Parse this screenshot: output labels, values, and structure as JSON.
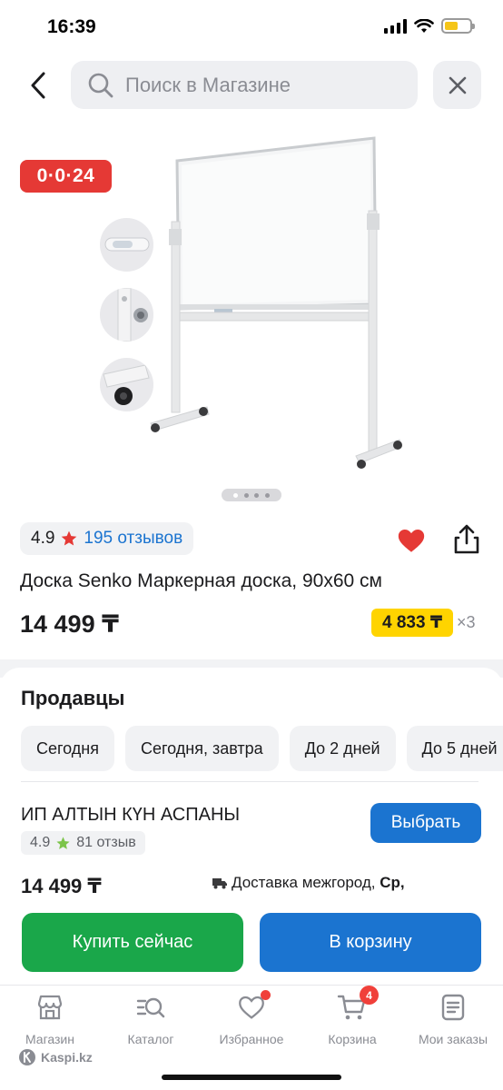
{
  "status_bar": {
    "time": "16:39"
  },
  "header": {
    "search_placeholder": "Поиск в Магазине"
  },
  "gallery": {
    "timer": "0·0·24",
    "thumbnails": 3,
    "dots_total": 4,
    "dots_active": 1
  },
  "product": {
    "rating": "4.9",
    "reviews": "195 отзывов",
    "title": "Доска Senko Маркерная доска, 90x60 см",
    "price": "14 499 ₸",
    "installment_amount": "4 833 ₸",
    "installment_months": "×3",
    "favorite_color": "#e53935"
  },
  "sellers": {
    "title": "Продавцы",
    "delivery_chips": [
      "Сегодня",
      "Сегодня, завтра",
      "До 2 дней",
      "До 5 дней"
    ],
    "first_seller": {
      "name": "ИП АЛТЫН КҮН АСПАНЫ",
      "rating": "4.9",
      "reviews": "81 отзыв",
      "choose_label": "Выбрать",
      "price": "14 499 ₸",
      "delivery_prefix": "Доставка межгород, ",
      "delivery_day": "Ср,"
    }
  },
  "actions": {
    "buy_now": "Купить сейчас",
    "add_to_cart": "В корзину"
  },
  "tab_bar": {
    "items": [
      {
        "label": "Магазин",
        "icon": "store-icon"
      },
      {
        "label": "Каталог",
        "icon": "catalog-search-icon"
      },
      {
        "label": "Избранное",
        "icon": "heart-icon"
      },
      {
        "label": "Корзина",
        "icon": "cart-icon",
        "badge": "4"
      },
      {
        "label": "Мои заказы",
        "icon": "orders-icon"
      }
    ]
  },
  "watermark": "Kaspi.kz",
  "colors": {
    "brand_blue": "#1b74d0",
    "buy_green": "#1aa74a",
    "timer_red": "#e53935",
    "installment_yellow": "#ffd400"
  }
}
